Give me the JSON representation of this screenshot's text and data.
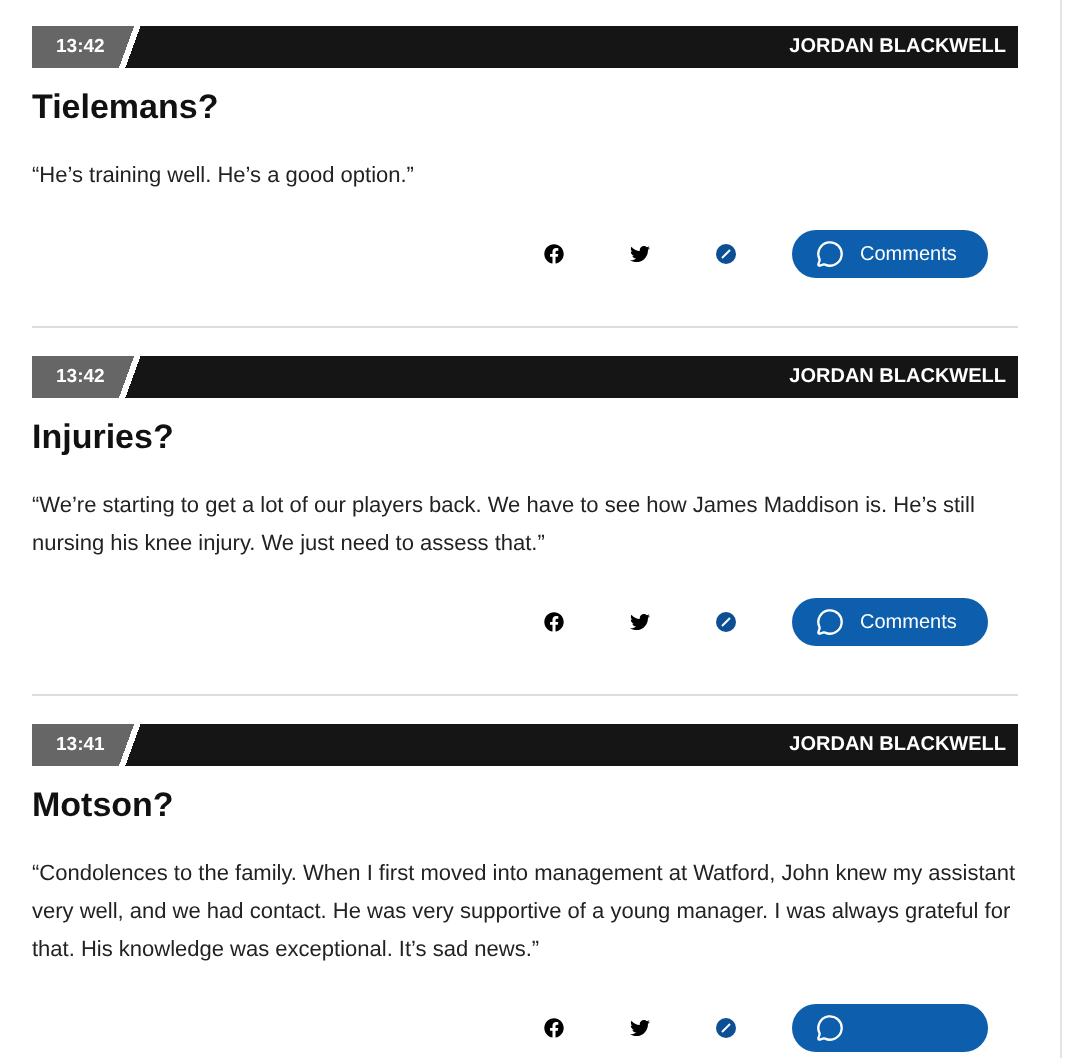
{
  "posts": [
    {
      "time": "13:42",
      "author": "JORDAN BLACKWELL",
      "title": "Tielemans?",
      "quote": "“He’s training well. He’s a good option.”",
      "comments_label": "Comments"
    },
    {
      "time": "13:42",
      "author": "JORDAN BLACKWELL",
      "title": "Injuries?",
      "quote": "“We’re starting to get a lot of our players back. We have to see how James Maddison is. He’s still nursing his knee injury. We just need to assess that.”",
      "comments_label": "Comments"
    },
    {
      "time": "13:41",
      "author": "JORDAN BLACKWELL",
      "title": "Motson?",
      "quote": "“Condolences to the family. When I first moved into management at Watford, John knew my assistant very well, and we had contact. He was very supportive of a young manager. I was always grateful for that. His knowledge was exceptional. It’s sad news.”"
    }
  ]
}
